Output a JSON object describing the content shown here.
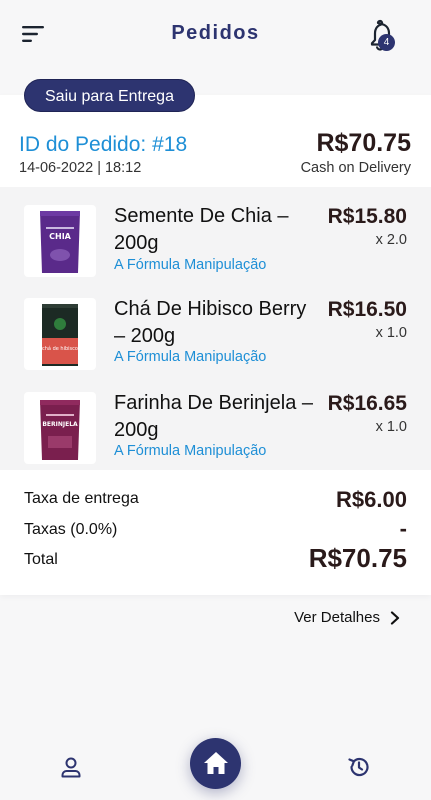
{
  "header": {
    "title": "Pedidos",
    "notification_count": "4",
    "icons": {
      "menu": "menu-icon",
      "notifications": "bell-icon"
    }
  },
  "order": {
    "status": "Saiu para Entrega",
    "id_label": "ID do Pedido: #18",
    "datetime": "14-06-2022 | 18:12",
    "total": "R$70.75",
    "payment_method": "Cash on Delivery"
  },
  "items": [
    {
      "name": "Semente De Chia – 200g",
      "brand": "A Fórmula Manipulação",
      "price": "R$15.80",
      "qty": "x 2.0",
      "package_color": "#5a2a8a",
      "package_label": "CHIA"
    },
    {
      "name": "Chá De Hibisco Berry – 200g",
      "brand": "A Fórmula Manipulação",
      "price": "R$16.50",
      "qty": "x 1.0",
      "package_color": "#1c2a24",
      "package_label": "chá de hibisco"
    },
    {
      "name": "Farinha De Berinjela – 200g",
      "brand": "A Fórmula Manipulação",
      "price": "R$16.65",
      "qty": "x 1.0",
      "package_color": "#7a1f4e",
      "package_label": "BERINJELA"
    }
  ],
  "summary": {
    "delivery_label": "Taxa de entrega",
    "delivery_value": "R$6.00",
    "taxes_label": "Taxas (0.0%)",
    "taxes_value": "-",
    "total_label": "Total",
    "total_value": "R$70.75"
  },
  "details_link": "Ver Detalhes",
  "bottom_nav": {
    "icons": {
      "profile": "user-icon",
      "home": "home-icon",
      "history": "history-icon"
    }
  },
  "colors": {
    "primary": "#2d3470",
    "accent_blue": "#1e8fd6",
    "price": "#2a1a1a",
    "background": "#f7f7f8"
  }
}
